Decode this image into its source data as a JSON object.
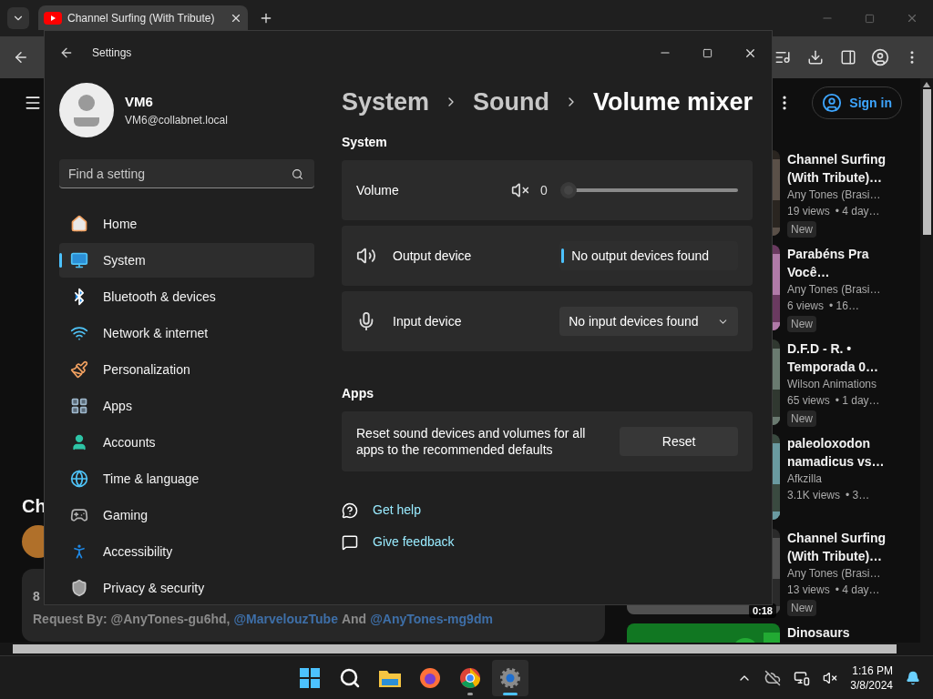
{
  "browser": {
    "tab_title": "Channel Surfing (With Tribute)",
    "sign_in": "Sign in",
    "video": {
      "title": "Ch",
      "description_count": "8",
      "description": [
        {
          "kind": "text",
          "text": "Request By: @AnyTones-gu6hd,"
        },
        {
          "kind": "link",
          "text": "@MarvelouzTube"
        },
        {
          "kind": "text",
          "text": "And"
        },
        {
          "kind": "link",
          "text": "@AnyTones-mg9dm"
        }
      ]
    },
    "recommendations": [
      {
        "title": "Channel Surfing (With Tribute)…",
        "channel": "Any Tones (Brasi…",
        "views": "19 views",
        "age": "• 4 day…",
        "badge": "New"
      },
      {
        "title": "Parabéns Pra Você…",
        "channel": "Any Tones (Brasi…",
        "views": "6 views",
        "age": "• 16…",
        "badge": "New"
      },
      {
        "title": "D.F.D - R. • Temporada 0…",
        "channel": "Wilson Animations",
        "views": "65 views",
        "age": "• 1 day…",
        "badge": "New"
      },
      {
        "title": "paleoloxodon namadicus vs…",
        "channel": "Afkzilla",
        "views": "3.1K views",
        "age": "• 3…"
      },
      {
        "title": "Channel Surfing (With Tribute)…",
        "channel": "Any Tones (Brasi…",
        "views": "13 views",
        "age": "• 4 day…",
        "badge": "New",
        "duration": "0:18"
      },
      {
        "title": "Dinosaurs"
      }
    ]
  },
  "settings": {
    "title": "Settings",
    "user": {
      "name": "VM6",
      "email": "VM6@collabnet.local"
    },
    "search": {
      "placeholder": "Find a setting"
    },
    "nav": [
      {
        "label": "Home",
        "selected": false
      },
      {
        "label": "System",
        "selected": true
      },
      {
        "label": "Bluetooth & devices",
        "selected": false
      },
      {
        "label": "Network & internet",
        "selected": false
      },
      {
        "label": "Personalization",
        "selected": false
      },
      {
        "label": "Apps",
        "selected": false
      },
      {
        "label": "Accounts",
        "selected": false
      },
      {
        "label": "Time & language",
        "selected": false
      },
      {
        "label": "Gaming",
        "selected": false
      },
      {
        "label": "Accessibility",
        "selected": false
      },
      {
        "label": "Privacy & security",
        "selected": false
      }
    ],
    "breadcrumb": [
      "System",
      "Sound",
      "Volume mixer"
    ],
    "system_heading": "System",
    "volume": {
      "label": "Volume",
      "muted": true,
      "reading": "0",
      "level": 0
    },
    "devices": [
      {
        "label": "Output device",
        "value": "No output devices found",
        "expanded": true
      },
      {
        "label": "Input device",
        "value": "No input devices found",
        "expanded": false
      }
    ],
    "apps_heading": "Apps",
    "reset": {
      "text": "Reset sound devices and volumes for all apps to the recommended defaults",
      "button": "Reset"
    },
    "links": [
      "Get help",
      "Give feedback"
    ]
  },
  "taskbar": {
    "apps": [
      {
        "running": false,
        "selected": false
      },
      {
        "running": false,
        "selected": false
      },
      {
        "running": false,
        "selected": false
      },
      {
        "running": false,
        "selected": false
      },
      {
        "running": true,
        "selected": false
      },
      {
        "running": true,
        "selected": true
      }
    ],
    "time": "1:16 PM",
    "date": "3/8/2024"
  }
}
